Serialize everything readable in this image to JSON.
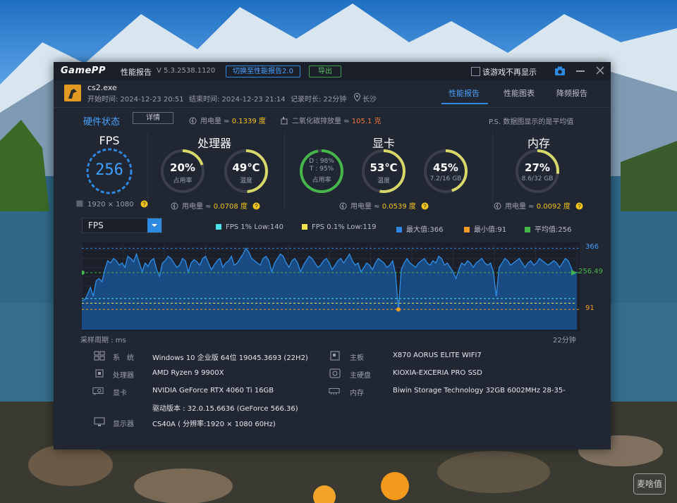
{
  "titlebar": {
    "logo": "GamePP",
    "title": "性能报告",
    "version": "V 5.3.2538.1120",
    "switch_button": "切换至性能报告2.0",
    "export_button": "导出",
    "dont_show_label": "该游戏不再显示"
  },
  "header": {
    "game_name": "cs2.exe",
    "start_time": "开始时间: 2024-12-23 20:51",
    "end_time": "结束时间: 2024-12-23 21:14",
    "duration": "记录时长: 22分钟",
    "location": "长沙",
    "tabs": [
      {
        "label": "性能报告",
        "active": true
      },
      {
        "label": "性能图表",
        "active": false
      },
      {
        "label": "降频报告",
        "active": false
      }
    ]
  },
  "hardware": {
    "title": "硬件状态",
    "detail_button": "详情",
    "total_power_label": "用电量 ≈",
    "total_power_value": "0.1339 度",
    "co2_label": "二氧化碳排放量 ≈",
    "co2_value": "105.1 克",
    "note": "P.S. 数据图显示的是平均值"
  },
  "fps_panel": {
    "title": "FPS",
    "value": "256",
    "resolution": "1920 × 1080"
  },
  "cpu_panel": {
    "title": "处理器",
    "usage_value": "20%",
    "usage_label": "占用率",
    "usage_fraction": 0.2,
    "temp_value": "49℃",
    "temp_label": "温度",
    "temp_fraction": 0.49,
    "power_label": "用电量 ≈",
    "power_value": "0.0708 度"
  },
  "gpu_panel": {
    "title": "显卡",
    "dt_line1": "D : 98%",
    "dt_line2": "T : 95%",
    "dt_label": "占用率",
    "dt_fraction": 0.97,
    "temp_value": "53℃",
    "temp_label": "温度",
    "temp_fraction": 0.53,
    "vram_value": "45%",
    "vram_label": "7.2/16 GB",
    "vram_fraction": 0.45,
    "power_label": "用电量 ≈",
    "power_value": "0.0539 度"
  },
  "mem_panel": {
    "title": "内存",
    "usage_value": "27%",
    "usage_label": "8.6/32 GB",
    "usage_fraction": 0.27,
    "power_label": "用电量 ≈",
    "power_value": "0.0092 度"
  },
  "chart_controls": {
    "metric": "FPS",
    "legend": [
      {
        "label": "FPS 1% Low:140",
        "color": "#4de3e8"
      },
      {
        "label": "FPS 0.1% Low:119",
        "color": "#f3e24a"
      },
      {
        "label": "最大值:366",
        "color": "#2d8ae0"
      },
      {
        "label": "最小值:91",
        "color": "#f19a24"
      },
      {
        "label": "平均值:256",
        "color": "#45b649"
      }
    ]
  },
  "chart_data": {
    "type": "area",
    "metric": "FPS",
    "x_start_label": "采样周期 : ms",
    "x_end_label": "22分钟",
    "max": 366,
    "min": 91,
    "avg": 256.49,
    "low1": 140,
    "low01": 119,
    "ylim": [
      0,
      380
    ],
    "y_labels": [
      "366",
      "256.49",
      "91"
    ],
    "values": [
      130,
      135,
      160,
      190,
      150,
      220,
      230,
      215,
      270,
      310,
      300,
      320,
      310,
      290,
      300,
      280,
      330,
      320,
      305,
      340,
      300,
      260,
      300,
      285,
      310,
      320,
      270,
      240,
      300,
      310,
      330,
      320,
      300,
      280,
      290,
      320,
      310,
      260,
      300,
      315,
      305,
      290,
      320,
      330,
      300,
      270,
      290,
      310,
      320,
      280,
      300,
      310,
      330,
      290,
      300,
      320,
      340,
      366,
      350,
      320,
      310,
      300,
      290,
      320,
      330,
      310,
      260,
      300,
      320,
      340,
      330,
      300,
      280,
      310,
      320,
      300,
      260,
      290,
      310,
      330,
      320,
      300,
      280,
      290,
      310,
      320,
      300,
      270,
      290,
      310,
      320,
      300,
      320,
      340,
      310,
      290,
      300,
      260,
      280,
      300,
      290,
      270,
      300,
      320,
      310,
      300,
      280,
      290,
      310,
      250,
      91,
      270,
      300,
      320,
      300,
      290,
      280,
      300,
      310,
      320,
      300,
      290,
      310,
      300,
      330,
      320,
      290,
      300,
      280,
      260,
      230,
      270,
      300,
      290,
      310,
      300,
      280,
      300,
      310,
      320,
      300,
      290,
      300,
      260,
      150,
      280,
      300,
      320,
      310,
      290,
      300,
      310,
      320,
      300,
      280,
      300,
      310,
      290,
      300,
      320,
      310,
      300,
      290,
      300,
      310,
      300,
      280,
      300,
      320,
      310,
      280,
      250,
      260
    ]
  },
  "sysinfo": {
    "left": [
      {
        "label": "系　统",
        "value": "Windows 10 企业版 64位 19045.3693 (22H2)",
        "icon": "windows-icon"
      },
      {
        "label": "处理器",
        "value": "AMD Ryzen 9 9900X",
        "icon": "cpu-icon"
      },
      {
        "label": "显卡",
        "value": "NVIDIA GeForce RTX 4060 Ti 16GB",
        "icon": "gpu-icon"
      },
      {
        "label": "",
        "value": "驱动版本 : 32.0.15.6636 (GeForce 566.36)",
        "icon": ""
      },
      {
        "label": "显示器",
        "value": "CS40A ( 分辨率:1920 × 1080 60Hz)",
        "icon": "monitor-icon"
      }
    ],
    "right": [
      {
        "label": "主板",
        "value": "X870 AORUS ELITE WIFI7",
        "icon": "motherboard-icon"
      },
      {
        "label": "主硬盘",
        "value": "KIOXIA-EXCERIA PRO SSD",
        "icon": "disk-icon"
      },
      {
        "label": "内存",
        "value": "Biwin Storage Technology 32GB 6002MHz 28-35-",
        "icon": "ram-icon"
      }
    ]
  },
  "watermark": "麦啥值",
  "colors": {
    "accent": "#2d8ae0",
    "gauge_track": "#3a3f4b",
    "gauge_fill": "#d8d86a",
    "gauge_green": "#45b649",
    "power_value": "#f5c518",
    "co2_value": "#f07a3c"
  }
}
